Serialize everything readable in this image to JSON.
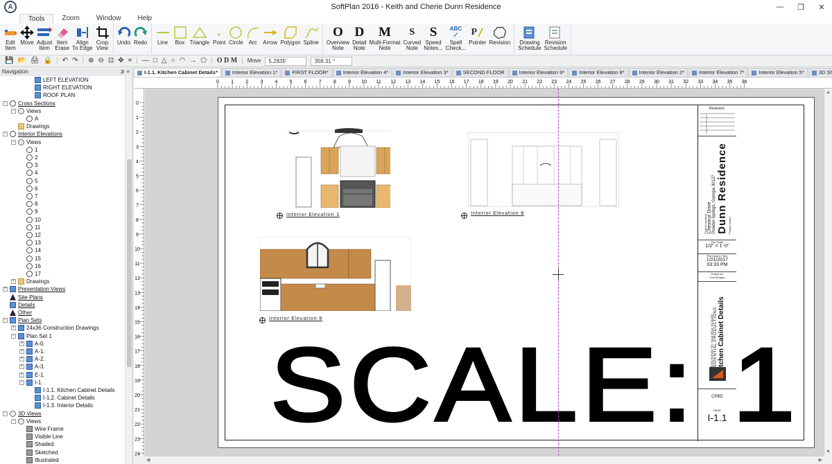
{
  "window": {
    "title": "SoftPlan 2016 - Keith and Cherie Dunn Residence",
    "app_logo": "A",
    "min": "—",
    "max": "❐",
    "close": "✕"
  },
  "menu_tabs": [
    "Tools",
    "Zoom",
    "Window",
    "Help"
  ],
  "ribbon": {
    "edit": [
      {
        "label": "Edit\nItem",
        "icon": "edit-item-icon"
      },
      {
        "label": "Move",
        "icon": "move-icon"
      },
      {
        "label": "Adjust\nItem",
        "icon": "adjust-item-icon"
      },
      {
        "label": "Item\nErase",
        "icon": "eraser-icon"
      },
      {
        "label": "Align\nTo Edge",
        "icon": "align-icon"
      },
      {
        "label": "Crop\nView",
        "icon": "crop-icon"
      }
    ],
    "undo": [
      {
        "label": "Undo",
        "icon": "undo-icon"
      },
      {
        "label": "Redo",
        "icon": "redo-icon"
      }
    ],
    "draw": [
      {
        "label": "Line",
        "icon": "line-icon"
      },
      {
        "label": "Box",
        "icon": "box-icon"
      },
      {
        "label": "Triangle",
        "icon": "triangle-icon"
      },
      {
        "label": "Point",
        "icon": "point-icon"
      },
      {
        "label": "Circle",
        "icon": "circle-icon"
      },
      {
        "label": "Arc",
        "icon": "arc-icon"
      },
      {
        "label": "Arrow",
        "icon": "arrow-icon"
      },
      {
        "label": "Polygon",
        "icon": "polygon-icon"
      },
      {
        "label": "Spline",
        "icon": "spline-icon"
      }
    ],
    "notes": [
      {
        "label": "Overview\nNote",
        "glyph": "O"
      },
      {
        "label": "Detail\nNote",
        "glyph": "D"
      },
      {
        "label": "Multi-Format\nNote",
        "glyph": "M"
      },
      {
        "label": "Curved\nNote",
        "glyph": "S"
      },
      {
        "label": "Speed\nNotes...",
        "glyph": "S"
      },
      {
        "label": "Spell\nCheck...",
        "glyph": "ABC"
      },
      {
        "label": "Pointer\n",
        "glyph": "P"
      },
      {
        "label": "Revision\n",
        "glyph": "cloud"
      }
    ],
    "schedules": [
      {
        "label": "Drawing\nSchedule",
        "icon": "drawing-schedule-icon"
      },
      {
        "label": "Revision\nSchedule",
        "icon": "revision-schedule-icon"
      }
    ]
  },
  "toolbar2": {
    "mode_label": "Move",
    "coord1": "5.2835'",
    "coord2": "358.31 °",
    "glyphs": "O D M"
  },
  "nav": {
    "title": "Navigation",
    "pin": "⊅ ×",
    "items": [
      {
        "label": "LEFT ELEVATION",
        "indent": 3,
        "icon": "page",
        "exp": ""
      },
      {
        "label": "RIGHT ELEVATION",
        "indent": 3,
        "icon": "page",
        "exp": ""
      },
      {
        "label": "ROOF PLAN",
        "indent": 3,
        "icon": "page",
        "exp": ""
      },
      {
        "label": "Cross Sections",
        "indent": 0,
        "icon": "sect",
        "exp": "−",
        "u": true
      },
      {
        "label": "Views",
        "indent": 1,
        "icon": "eye",
        "exp": "−"
      },
      {
        "label": "A",
        "indent": 2,
        "icon": "sect",
        "exp": ""
      },
      {
        "label": "Drawings",
        "indent": 1,
        "icon": "fold",
        "exp": ""
      },
      {
        "label": "Interior Elevations",
        "indent": 0,
        "icon": "sect",
        "exp": "−",
        "u": true
      },
      {
        "label": "Views",
        "indent": 1,
        "icon": "eye",
        "exp": "−"
      },
      {
        "label": "1",
        "indent": 2,
        "icon": "sect",
        "exp": ""
      },
      {
        "label": "2",
        "indent": 2,
        "icon": "sect",
        "exp": ""
      },
      {
        "label": "3",
        "indent": 2,
        "icon": "sect",
        "exp": ""
      },
      {
        "label": "4",
        "indent": 2,
        "icon": "sect",
        "exp": ""
      },
      {
        "label": "5",
        "indent": 2,
        "icon": "sect",
        "exp": ""
      },
      {
        "label": "6",
        "indent": 2,
        "icon": "sect",
        "exp": ""
      },
      {
        "label": "7",
        "indent": 2,
        "icon": "sect",
        "exp": ""
      },
      {
        "label": "8",
        "indent": 2,
        "icon": "sect",
        "exp": ""
      },
      {
        "label": "9",
        "indent": 2,
        "icon": "sect",
        "exp": ""
      },
      {
        "label": "10",
        "indent": 2,
        "icon": "sect",
        "exp": ""
      },
      {
        "label": "11",
        "indent": 2,
        "icon": "sect",
        "exp": ""
      },
      {
        "label": "12",
        "indent": 2,
        "icon": "sect",
        "exp": ""
      },
      {
        "label": "13",
        "indent": 2,
        "icon": "sect",
        "exp": ""
      },
      {
        "label": "14",
        "indent": 2,
        "icon": "sect",
        "exp": ""
      },
      {
        "label": "15",
        "indent": 2,
        "icon": "sect",
        "exp": ""
      },
      {
        "label": "16",
        "indent": 2,
        "icon": "sect",
        "exp": ""
      },
      {
        "label": "17",
        "indent": 2,
        "icon": "sect",
        "exp": ""
      },
      {
        "label": "Drawings",
        "indent": 1,
        "icon": "fold",
        "exp": "+"
      },
      {
        "label": "Presentation Views",
        "indent": 0,
        "icon": "page",
        "exp": "+",
        "u": true
      },
      {
        "label": "Site Plans",
        "indent": 0,
        "icon": "a",
        "exp": "",
        "u": true
      },
      {
        "label": "Details",
        "indent": 0,
        "icon": "page",
        "exp": "",
        "u": true
      },
      {
        "label": "Other",
        "indent": 0,
        "icon": "a",
        "exp": "",
        "u": true
      },
      {
        "label": "Plan Sets",
        "indent": 0,
        "icon": "page",
        "exp": "−",
        "u": true
      },
      {
        "label": "24x36 Construction Drawings",
        "indent": 1,
        "icon": "page",
        "exp": "+"
      },
      {
        "label": "Plan Set 1",
        "indent": 1,
        "icon": "page",
        "exp": "−"
      },
      {
        "label": "A-0.",
        "indent": 2,
        "icon": "page",
        "exp": "+"
      },
      {
        "label": "A-1.",
        "indent": 2,
        "icon": "page",
        "exp": "+"
      },
      {
        "label": "A-2.",
        "indent": 2,
        "icon": "page",
        "exp": "+"
      },
      {
        "label": "A-3.",
        "indent": 2,
        "icon": "page",
        "exp": "+"
      },
      {
        "label": "E-1.",
        "indent": 2,
        "icon": "page",
        "exp": "+"
      },
      {
        "label": "I-1.",
        "indent": 2,
        "icon": "page",
        "exp": "−"
      },
      {
        "label": "I-1.1. Kitchen Cabinet Details",
        "indent": 3,
        "icon": "page",
        "exp": ""
      },
      {
        "label": "I-1.2. Cabinet Details",
        "indent": 3,
        "icon": "page",
        "exp": ""
      },
      {
        "label": "I-1.3. Interior Details",
        "indent": 3,
        "icon": "page",
        "exp": ""
      },
      {
        "label": "3D Views",
        "indent": 0,
        "icon": "eye",
        "exp": "−",
        "u": true
      },
      {
        "label": "Views",
        "indent": 1,
        "icon": "eye",
        "exp": "−"
      },
      {
        "label": "Wire Frame",
        "indent": 2,
        "icon": "3d",
        "exp": ""
      },
      {
        "label": "Visible Line",
        "indent": 2,
        "icon": "3d",
        "exp": ""
      },
      {
        "label": "Shaded",
        "indent": 2,
        "icon": "3d",
        "exp": ""
      },
      {
        "label": "Sketched",
        "indent": 2,
        "icon": "3d",
        "exp": ""
      },
      {
        "label": "Illustrated",
        "indent": 2,
        "icon": "3d",
        "exp": ""
      }
    ]
  },
  "doc_tabs": [
    {
      "label": "I-1.1. Kitchen Cabinet Details*",
      "active": true
    },
    {
      "label": "Interior Elevation 1*"
    },
    {
      "label": "FIRST FLOOR*"
    },
    {
      "label": "Interior Elevation 4*"
    },
    {
      "label": "Interior Elevation 3*"
    },
    {
      "label": "SECOND FLOOR"
    },
    {
      "label": "Interior Elevation 9*"
    },
    {
      "label": "Interior Elevation 8*"
    },
    {
      "label": "Interior Elevation 2*"
    },
    {
      "label": "Interior Elevation 7*"
    },
    {
      "label": "Interior Elevation 5*"
    },
    {
      "label": "3D Shaded*"
    }
  ],
  "ruler_h": [
    "0",
    "1",
    "2",
    "3",
    "4",
    "5",
    "6",
    "7",
    "8",
    "9",
    "10",
    "11",
    "12",
    "13",
    "14",
    "15",
    "16",
    "17",
    "18",
    "19",
    "20",
    "21",
    "22",
    "23",
    "24",
    "25",
    "26",
    "27",
    "28",
    "29",
    "30",
    "31",
    "32",
    "33",
    "34",
    "35",
    "36"
  ],
  "ruler_v": [
    "0",
    "1",
    "2",
    "3",
    "4",
    "5",
    "6",
    "7",
    "8",
    "9",
    "10",
    "11",
    "12",
    "13",
    "14",
    "15",
    "16",
    "17",
    "18",
    "19",
    "20",
    "21",
    "22",
    "23",
    "24"
  ],
  "sheet": {
    "elevations": [
      {
        "label": "Interior Elevation 1"
      },
      {
        "label": "Interior Elevation 8"
      },
      {
        "label": "Interior Elevation 9"
      }
    ],
    "scale_text": "SCALE: 1",
    "title_block": {
      "revisions_label": "Revisions:",
      "project_label": "Project Name:",
      "project_name": "Dunn Residence",
      "address_label": "Project Location:",
      "address1": "Chestnut Drive",
      "address2": "Powder Springs, Georgia 30127",
      "plot_scale_label": "Plot Scale",
      "plot_scale": "1/2\" = 1'-0\"",
      "date_label": "Plot Date & Time",
      "date": "1/21/2017",
      "time": "03:33 PM",
      "drawn_label": "Drawn by:",
      "drawn_by": "Tom Morgan",
      "sheet_title": "Kitchen Cabinet Details",
      "company": "RESIDENTIAL PRODUCTIONS",
      "company_addr": "169 MOSS POINTE RD.  VILLA RICA, GA 30180",
      "sheet_label": "PAGE",
      "sheet_code": "CPBD",
      "sheet_number": "I-1.1"
    }
  },
  "colors": {
    "accent": "#2b64b6",
    "guide": "#c040c0",
    "cabinet": "#d9a45a",
    "canvas": "#d4d4d4"
  }
}
